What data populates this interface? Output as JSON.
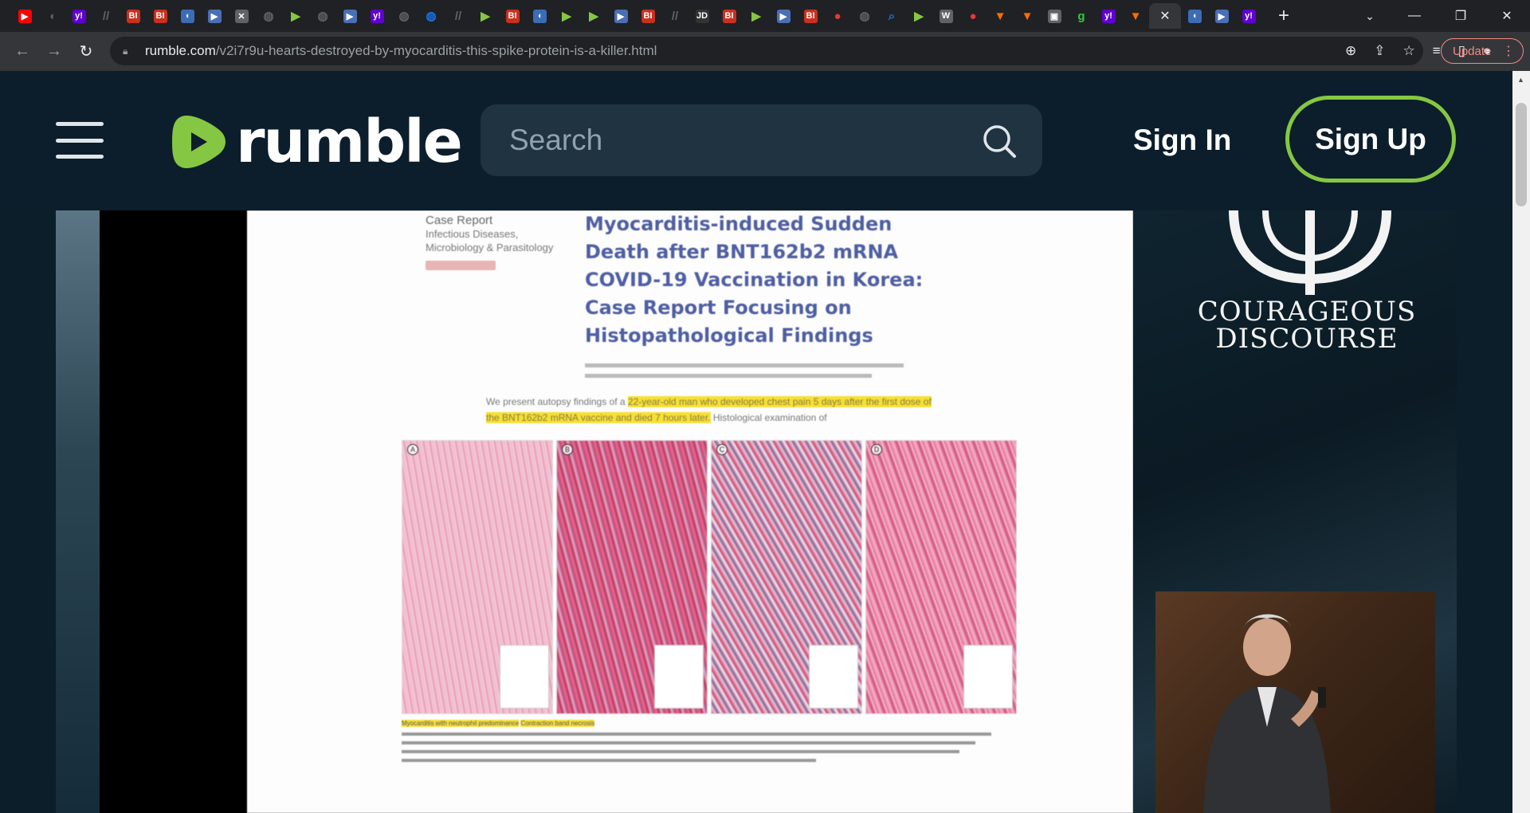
{
  "browser": {
    "tabs": [
      {
        "icon": "youtube-icon",
        "color": "#ff0000",
        "glyph": "▶"
      },
      {
        "icon": "shield-icon",
        "color": "#5f6368",
        "glyph": "◖"
      },
      {
        "icon": "yahoo-icon",
        "color": "#6001d2",
        "glyph": "y!"
      },
      {
        "icon": "slashes-icon",
        "color": "#5f6368",
        "glyph": "//"
      },
      {
        "icon": "bi-icon",
        "color": "#c9301e",
        "glyph": "BI"
      },
      {
        "icon": "bi-icon",
        "color": "#c9301e",
        "glyph": "BI"
      },
      {
        "icon": "shield-icon",
        "color": "#3b6cb5",
        "glyph": "◖"
      },
      {
        "icon": "flag-icon",
        "color": "#4a6fb5",
        "glyph": "▶"
      },
      {
        "icon": "x-icon",
        "color": "#ffffff",
        "glyph": "✕"
      },
      {
        "icon": "globe-icon",
        "color": "#5f6368",
        "glyph": "◍"
      },
      {
        "icon": "rumble-icon",
        "color": "#85c742",
        "glyph": "▶"
      },
      {
        "icon": "globe-icon",
        "color": "#5f6368",
        "glyph": "◍"
      },
      {
        "icon": "flag-icon",
        "color": "#4a6fb5",
        "glyph": "▶"
      },
      {
        "icon": "yahoo-icon",
        "color": "#6001d2",
        "glyph": "y!"
      },
      {
        "icon": "globe-icon",
        "color": "#5f6368",
        "glyph": "◍"
      },
      {
        "icon": "globe-icon",
        "color": "#1a73e8",
        "glyph": "◍"
      },
      {
        "icon": "slashes-icon",
        "color": "#5f6368",
        "glyph": "//"
      },
      {
        "icon": "rumble-icon",
        "color": "#85c742",
        "glyph": "▶"
      },
      {
        "icon": "bi-icon",
        "color": "#c9301e",
        "glyph": "BI"
      },
      {
        "icon": "shield-icon",
        "color": "#3b6cb5",
        "glyph": "◖"
      },
      {
        "icon": "rumble-icon",
        "color": "#85c742",
        "glyph": "▶"
      },
      {
        "icon": "rumble-icon",
        "color": "#85c742",
        "glyph": "▶"
      },
      {
        "icon": "flag-icon",
        "color": "#4a6fb5",
        "glyph": "▶"
      },
      {
        "icon": "bi-icon",
        "color": "#c9301e",
        "glyph": "BI"
      },
      {
        "icon": "slashes-icon",
        "color": "#5f6368",
        "glyph": "//"
      },
      {
        "icon": "jd-icon",
        "color": "#333333",
        "glyph": "JD"
      },
      {
        "icon": "bi-icon",
        "color": "#c9301e",
        "glyph": "BI"
      },
      {
        "icon": "rumble-icon",
        "color": "#85c742",
        "glyph": "▶"
      },
      {
        "icon": "flag-icon",
        "color": "#4a6fb5",
        "glyph": "▶"
      },
      {
        "icon": "bi-icon",
        "color": "#c9301e",
        "glyph": "BI"
      },
      {
        "icon": "pin-icon",
        "color": "#e53935",
        "glyph": "●"
      },
      {
        "icon": "globe-icon",
        "color": "#5f6368",
        "glyph": "◍"
      },
      {
        "icon": "search-icon",
        "color": "#1a73e8",
        "glyph": "⌕"
      },
      {
        "icon": "rumble-icon",
        "color": "#85c742",
        "glyph": "▶"
      },
      {
        "icon": "wsj-icon",
        "color": "#ffffff",
        "glyph": "W"
      },
      {
        "icon": "pin-icon",
        "color": "#e53935",
        "glyph": "●"
      },
      {
        "icon": "bookmark-icon",
        "color": "#ff6d00",
        "glyph": "▼"
      },
      {
        "icon": "bookmark-icon",
        "color": "#ff6d00",
        "glyph": "▼"
      },
      {
        "icon": "lock-icon",
        "color": "#ffffff",
        "glyph": "▣"
      },
      {
        "icon": "g-icon",
        "color": "#2ecc40",
        "glyph": "g"
      },
      {
        "icon": "yahoo-icon",
        "color": "#6001d2",
        "glyph": "y!"
      },
      {
        "icon": "bookmark-icon",
        "color": "#ff6d00",
        "glyph": "▼"
      },
      {
        "icon": "close-icon",
        "color": "#e8eaed",
        "glyph": "✕",
        "active": true
      },
      {
        "icon": "shield-icon",
        "color": "#3b6cb5",
        "glyph": "◖"
      },
      {
        "icon": "flag-icon",
        "color": "#4a6fb5",
        "glyph": "▶"
      },
      {
        "icon": "yahoo-icon",
        "color": "#6001d2",
        "glyph": "y!"
      }
    ],
    "url_host": "rumble.com",
    "url_path": "/v2i7r9u-hearts-destroyed-by-myocarditis-this-spike-protein-is-a-killer.html",
    "update_label": "Update"
  },
  "header": {
    "logo_text": "rumble",
    "search_placeholder": "Search",
    "signin_label": "Sign In",
    "signup_label": "Sign Up",
    "accent": "#85c742"
  },
  "video": {
    "slide": {
      "case_label": "Case Report",
      "case_section": "Infectious Diseases, Microbiology & Parasitology",
      "title": "Myocarditis-induced Sudden Death after BNT162b2 mRNA COVID-19 Vaccination in Korea: Case Report Focusing on Histopathological Findings",
      "abstract_lead": "We present autopsy findings of a",
      "abstract_highlight": "22-year-old man who developed chest pain 5 days after the first dose of the BNT162b2 mRNA vaccine and died 7 hours later.",
      "abstract_tail": "Histological examination of",
      "caption_highlight_1": "Myocarditis with neutrophil predominance",
      "caption_highlight_2": "Contraction band necrosis"
    },
    "brand_line1": "COURAGEOUS",
    "brand_line2": "DISCOURSE"
  }
}
